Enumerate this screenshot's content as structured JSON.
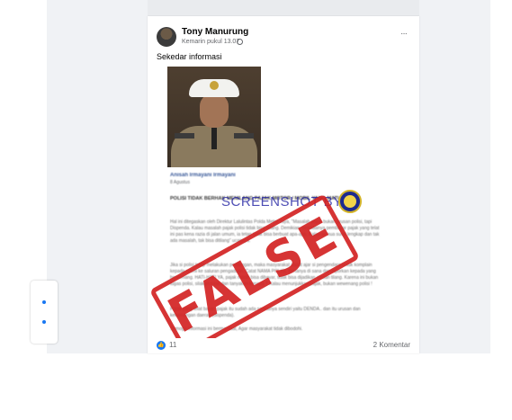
{
  "post": {
    "author": "Tony Manurung",
    "timestamp": "Kemarin pukul 13.07",
    "caption": "Sekedar informasi",
    "more_glyph": "···"
  },
  "shared_image": {
    "article_author": "Anisah Irmayani Irmayani",
    "article_date": "8 Agustus",
    "headline": "POLISI TIDAK BERHAK MENILANG PAJAK MOTOR / MOBIL YANG MATI !",
    "paragraphs": [
      "Hal ini ditegaskan oleh Direktur Lalulintas Polda Metro Jaya, \"Masalah pajak bukan urusan polisi, tapi Dispenda. Kalau masalah pajak polisi tidak bisa nilang. Demikian, seandainya pembayar pajak yang telat ini pas kena razia di jalan umum, ia tetap tidak bisa berbuat apa-apa. Kalau semua surat lengkap dan tak ada masalah, tak bisa ditilang\" ucapnya.",
      "Jika si polisi tetap melakukan penilangan, maka masyarakat dapat ajar si pengendara untuk komplain kepada resmi ke saluran pengaduan. Catat NAMA POLISI, bertanya di sana dan laporkan kepada yang berwenang. HATI-HATI YA, pajak masih bisa dibayar, tidak bisa dijadikan alasan tilang. Karena ini bukan tugas polisi, silakan tolak dan tanyakan kenapa ? Kalau menunjukkan pajak, bukan wewenang polisi !",
      "Pajak yang telat bayar, pajak itu sudah ada sanksinya sendiri yaitu DENDA.. dan itu urusan dan kewenangan daerah (dispenda).",
      "Semoga informasi ini bermanfaat, Agar masyarakat tidak dibodohi."
    ],
    "watermark_text": "SCREENSHOT BY",
    "stamp_text": "FALSE"
  },
  "engagement": {
    "like_glyph": "👍",
    "reactions": "11",
    "comments": "2 Komentar"
  },
  "colors": {
    "fb_blue": "#1877f2",
    "stamp_red": "#d32323",
    "watermark_blue": "#1c1ca0"
  }
}
